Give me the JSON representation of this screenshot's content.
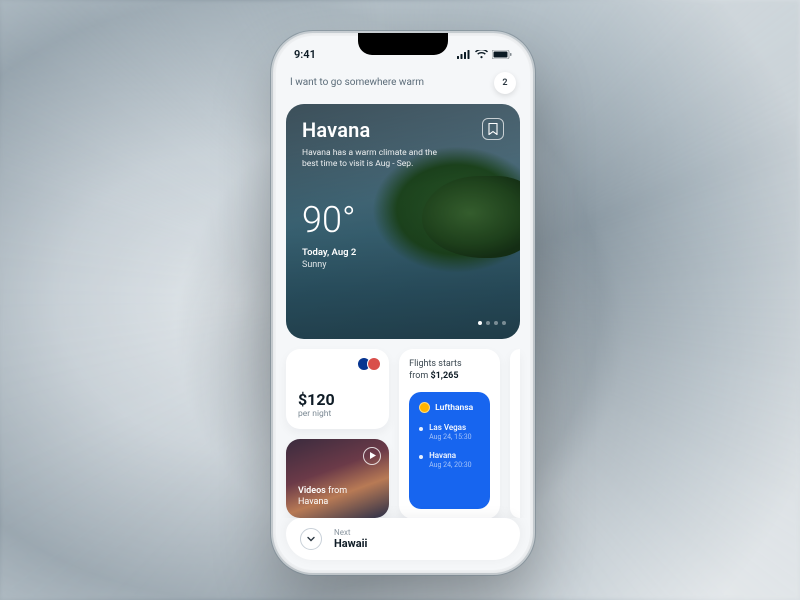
{
  "status": {
    "time": "9:41"
  },
  "search": {
    "query": "I want to go somewhere warm",
    "badge": "2"
  },
  "hero": {
    "title": "Havana",
    "description": "Havana has a warm climate and the best time to visit is Aug - Sep.",
    "temperature": "90°",
    "date_label": "Today, Aug 2",
    "condition": "Sunny"
  },
  "price_card": {
    "amount": "$120",
    "unit": "per night"
  },
  "video_card": {
    "prefix": "Videos",
    "suffix": " from Havana"
  },
  "flights_card": {
    "line1": "Flights starts",
    "line2_prefix": "from ",
    "line2_amount": "$1,265",
    "airline": "Lufthansa",
    "legs": [
      {
        "city": "Las Vegas",
        "time": "Aug 24, 15:30"
      },
      {
        "city": "Havana",
        "time": "Aug 24, 20:30"
      }
    ]
  },
  "next": {
    "label": "Next",
    "destination": "Hawaii"
  }
}
